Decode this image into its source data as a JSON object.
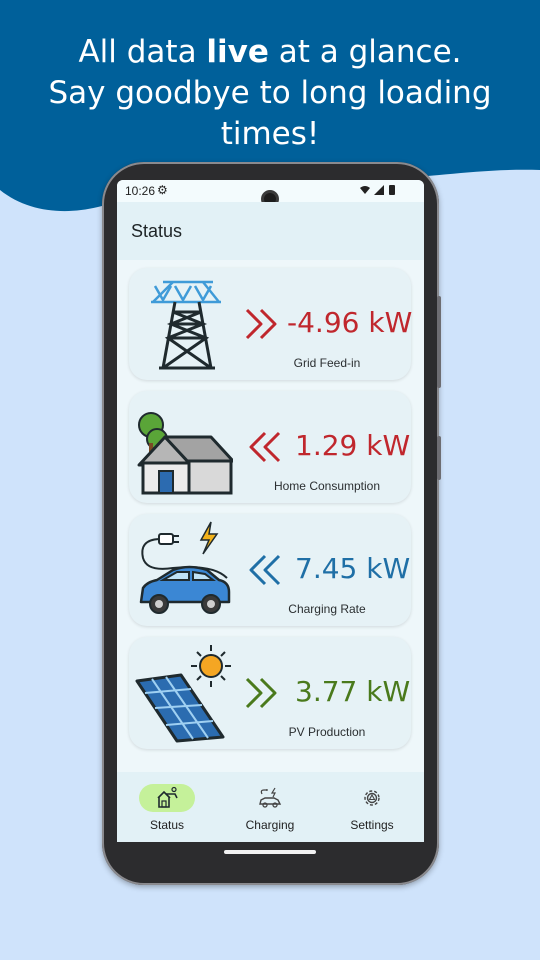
{
  "promo": {
    "headline_pre": "All data ",
    "headline_bold": "live",
    "headline_post": " at a glance.",
    "headline_line2": "Say goodbye to long loading",
    "headline_line3": "times!",
    "bg_color": "#00609a"
  },
  "status_bar": {
    "time": "10:26",
    "settings_icon": "gear-icon",
    "indicators": "wifi, signal, battery"
  },
  "app_bar": {
    "title": "Status"
  },
  "cards": [
    {
      "name": "grid",
      "value": "-4.96 kW",
      "label": "Grid Feed-in",
      "direction": "right",
      "color": "#c0272d",
      "icon": "power-pylon-icon"
    },
    {
      "name": "home",
      "value": "1.29 kW",
      "label": "Home Consumption",
      "direction": "left",
      "color": "#c0272d",
      "icon": "house-icon"
    },
    {
      "name": "charging",
      "value": "7.45 kW",
      "label": "Charging Rate",
      "direction": "left",
      "color": "#1f6fa6",
      "icon": "electric-car-icon"
    },
    {
      "name": "pv",
      "value": "3.77 kW",
      "label": "PV Production",
      "direction": "right",
      "color": "#4a7a1c",
      "icon": "solar-panel-icon"
    }
  ],
  "nav": {
    "items": [
      {
        "label": "Status",
        "icon": "house-solar-icon",
        "active": true
      },
      {
        "label": "Charging",
        "icon": "car-charging-icon",
        "active": false
      },
      {
        "label": "Settings",
        "icon": "gear-icon",
        "active": false
      }
    ],
    "active_color": "#c5f19a"
  }
}
